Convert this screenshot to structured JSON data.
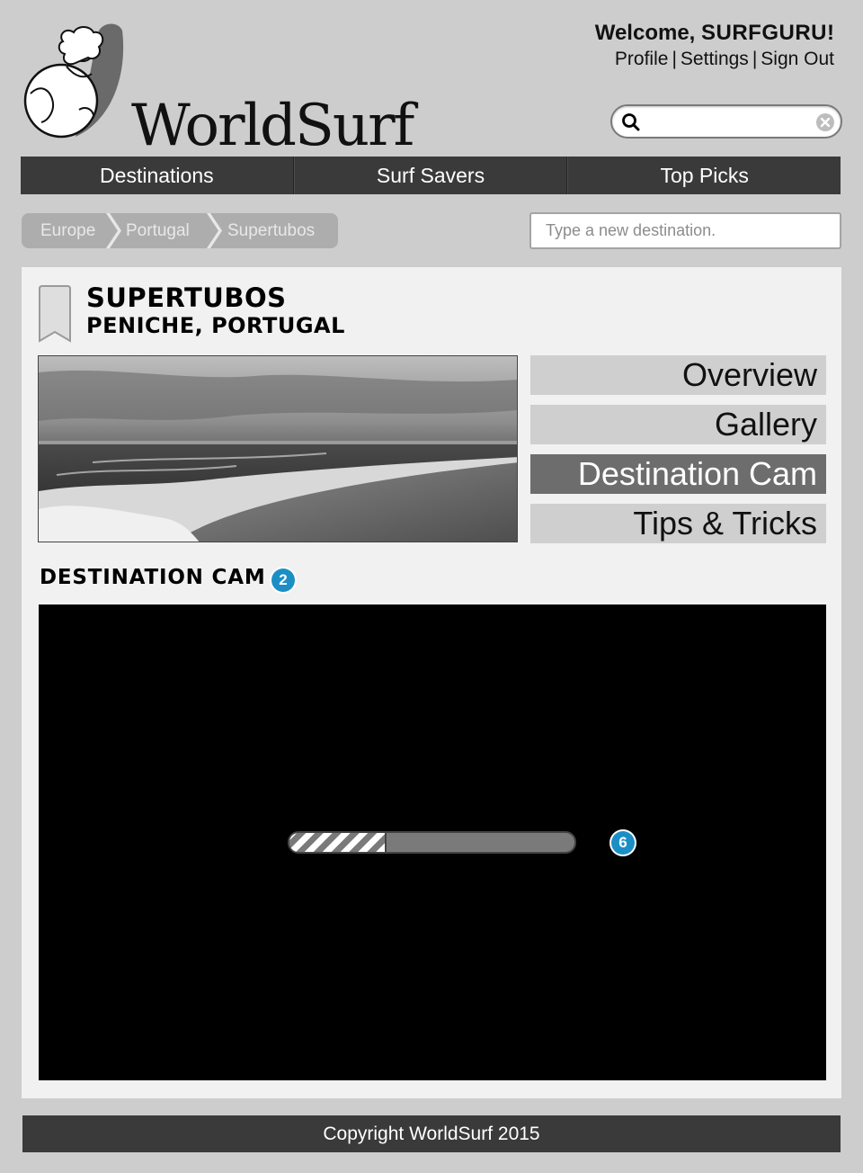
{
  "brand": {
    "name": "WorldSurf"
  },
  "account": {
    "welcome_prefix": "Welcome, ",
    "username": "SURFGURU",
    "welcome_suffix": "!",
    "links": [
      "Profile",
      "Settings",
      "Sign Out"
    ],
    "separator": "|"
  },
  "search": {
    "value": "",
    "placeholder": ""
  },
  "nav": {
    "items": [
      "Destinations",
      "Surf Savers",
      "Top Picks"
    ]
  },
  "breadcrumb": {
    "items": [
      "Europe",
      "Portugal",
      "Supertubos"
    ]
  },
  "destination_input": {
    "placeholder": "Type a new destination.",
    "value": ""
  },
  "spot": {
    "title": "SUPERTUBOS",
    "subtitle": "PENICHE, PORTUGAL"
  },
  "side_tabs": {
    "items": [
      "Overview",
      "Gallery",
      "Destination Cam",
      "Tips & Tricks"
    ],
    "active": "Destination Cam"
  },
  "section": {
    "title": "DESTINATION CAM",
    "badge": "2"
  },
  "video": {
    "progress_percent": 34,
    "badge": "6"
  },
  "footer": {
    "text": "Copyright WorldSurf 2015"
  },
  "colors": {
    "background": "#cdcdcd",
    "nav_bar": "#3a3a3a",
    "panel": "#f1f1f1",
    "active_tab": "#6d6d6d",
    "badge": "#1b8fc5"
  }
}
